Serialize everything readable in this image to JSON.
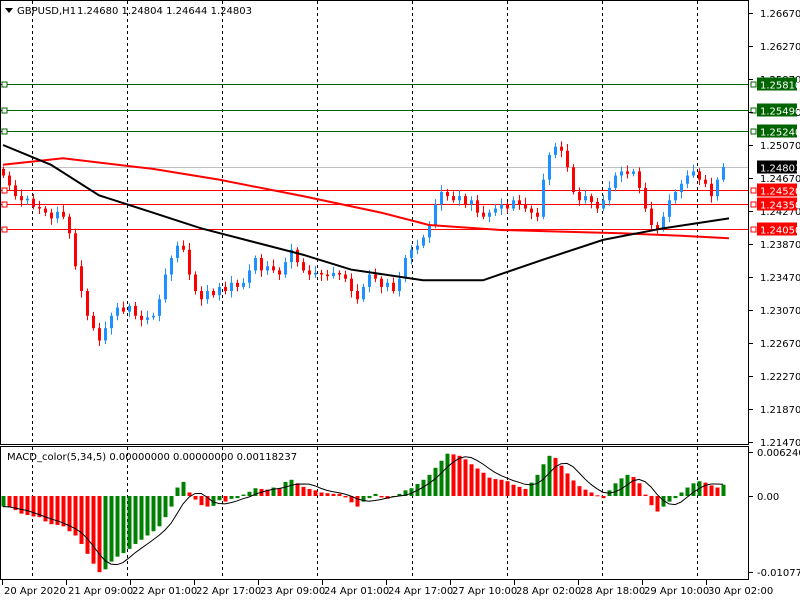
{
  "header": {
    "symbol": "GBPUSD,H1",
    "ohlc": "1.24680 1.24804 1.24644 1.24803",
    "menu_icon": "triangle-down-icon"
  },
  "indicator": {
    "label": "MACD_color(5,34,5) 0.00000000 0.00000000 0.00118237"
  },
  "colors": {
    "bull_candle": "#1E90FF",
    "bear_candle": "#FF0000",
    "ma_fast": "#000000",
    "ma_slow": "#FF0000",
    "level_green": "#006400",
    "level_red": "#FF0000",
    "current_price": "#000000",
    "hist_up": "#008000",
    "hist_down": "#FF0000"
  },
  "chart_data": [
    {
      "type": "candlestick",
      "title": "GBPUSD,H1",
      "x_tick_labels": [
        "20 Apr 2020",
        "21 Apr 09:00",
        "22 Apr 01:00",
        "22 Apr 17:00",
        "23 Apr 09:00",
        "24 Apr 01:00",
        "24 Apr 17:00",
        "27 Apr 10:00",
        "28 Apr 02:00",
        "28 Apr 18:00",
        "29 Apr 10:00",
        "30 Apr 02:00"
      ],
      "y_tick_labels": [
        "1.26670",
        "1.26270",
        "1.25870",
        "1.25470",
        "1.25070",
        "1.24670",
        "1.24270",
        "1.23870",
        "1.23470",
        "1.23070",
        "1.22670",
        "1.22270",
        "1.21870",
        "1.21470"
      ],
      "ylim": [
        1.214,
        1.2683
      ],
      "grid": "vertical dashed",
      "close": [
        1.247,
        1.2458,
        1.2445,
        1.244,
        1.2442,
        1.2432,
        1.243,
        1.2425,
        1.2418,
        1.2426,
        1.242,
        1.24,
        1.236,
        1.233,
        1.23,
        1.2285,
        1.227,
        1.2285,
        1.23,
        1.231,
        1.2305,
        1.2312,
        1.23,
        1.2295,
        1.2298,
        1.23,
        1.232,
        1.235,
        1.237,
        1.2385,
        1.238,
        1.235,
        1.233,
        1.232,
        1.233,
        1.2325,
        1.2335,
        1.233,
        1.234,
        1.2335,
        1.234,
        1.2355,
        1.237,
        1.2355,
        1.236,
        1.2355,
        1.235,
        1.2365,
        1.238,
        1.2365,
        1.2355,
        1.235,
        1.2352,
        1.235,
        1.2348,
        1.2352,
        1.235,
        1.2345,
        1.233,
        1.232,
        1.2335,
        1.235,
        1.2345,
        1.2335,
        1.234,
        1.233,
        1.2345,
        1.237,
        1.238,
        1.2385,
        1.2395,
        1.241,
        1.2435,
        1.245,
        1.2445,
        1.244,
        1.2445,
        1.2435,
        1.244,
        1.2425,
        1.242,
        1.2425,
        1.243,
        1.2435,
        1.243,
        1.244,
        1.2435,
        1.243,
        1.2425,
        1.242,
        1.2465,
        1.2495,
        1.2505,
        1.25,
        1.248,
        1.245,
        1.244,
        1.2445,
        1.2438,
        1.243,
        1.244,
        1.2455,
        1.247,
        1.2475,
        1.2472,
        1.2475,
        1.2455,
        1.243,
        1.241,
        1.2405,
        1.242,
        1.244,
        1.245,
        1.246,
        1.247,
        1.2475,
        1.2465,
        1.246,
        1.2445,
        1.2465,
        1.24803
      ],
      "ma_fast_points": [
        [
          0,
          1.2507
        ],
        [
          8,
          1.2483
        ],
        [
          16,
          1.2446
        ],
        [
          25,
          1.2425
        ],
        [
          33,
          1.2406
        ],
        [
          50,
          1.2374
        ],
        [
          58,
          1.2356
        ],
        [
          70,
          1.2343
        ],
        [
          80,
          1.2343
        ],
        [
          90,
          1.2368
        ],
        [
          100,
          1.2392
        ],
        [
          110,
          1.2406
        ],
        [
          121,
          1.2418
        ]
      ],
      "ma_slow_points": [
        [
          0,
          1.2483
        ],
        [
          10,
          1.2491
        ],
        [
          25,
          1.2478
        ],
        [
          36,
          1.2465
        ],
        [
          50,
          1.2445
        ],
        [
          63,
          1.2425
        ],
        [
          71,
          1.241
        ],
        [
          83,
          1.2404
        ],
        [
          93,
          1.2402
        ],
        [
          103,
          1.24
        ],
        [
          113,
          1.2397
        ],
        [
          121,
          1.2394
        ]
      ],
      "levels": [
        {
          "price": "1.25810",
          "color": "green"
        },
        {
          "price": "1.25490",
          "color": "green"
        },
        {
          "price": "1.25240",
          "color": "green"
        },
        {
          "price": "1.24803",
          "color": "current"
        },
        {
          "price": "1.24520",
          "color": "red"
        },
        {
          "price": "1.24350",
          "color": "red"
        },
        {
          "price": "1.24050",
          "color": "red"
        }
      ]
    },
    {
      "type": "bar",
      "title": "MACD_color(5,34,5)",
      "y_tick_labels": [
        "0.0062401",
        "0.00",
        "-0.010771"
      ],
      "ylim": [
        -0.010771,
        0.0062401
      ],
      "histogram": [
        -0.0015,
        -0.0016,
        -0.002,
        -0.0025,
        -0.0027,
        -0.0029,
        -0.003,
        -0.0036,
        -0.004,
        -0.0041,
        -0.0043,
        -0.005,
        -0.0056,
        -0.0068,
        -0.0082,
        -0.0096,
        -0.0108,
        -0.0104,
        -0.0093,
        -0.0086,
        -0.0081,
        -0.0075,
        -0.0068,
        -0.0062,
        -0.0056,
        -0.005,
        -0.0043,
        -0.003,
        -0.0015,
        0.0012,
        0.002,
        0.0005,
        -0.0005,
        -0.0013,
        -0.0015,
        -0.0014,
        -0.0006,
        -0.0008,
        -0.0004,
        -0.0003,
        0.0002,
        0.0006,
        0.0011,
        0.001,
        0.0009,
        0.0012,
        0.0011,
        0.002,
        0.0023,
        0.0018,
        0.0013,
        0.001,
        0.0008,
        0.0005,
        0.0004,
        0.0003,
        0.0003,
        -0.0002,
        -0.0009,
        -0.0015,
        -0.0008,
        -0.0003,
        0.0003,
        -0.0002,
        -0.0004,
        0.0,
        0.0003,
        0.0008,
        0.0011,
        0.0017,
        0.0023,
        0.003,
        0.004,
        0.005,
        0.006,
        0.0059,
        0.0057,
        0.0052,
        0.0045,
        0.0039,
        0.0033,
        0.0026,
        0.0024,
        0.0023,
        0.0021,
        0.0016,
        0.0013,
        0.001,
        0.0019,
        0.003,
        0.0045,
        0.0057,
        0.0054,
        0.0043,
        0.0032,
        0.0022,
        0.0014,
        0.0009,
        0.0005,
        0.0001,
        -0.0003,
        0.0008,
        0.0018,
        0.0025,
        0.003,
        0.0027,
        0.0018,
        0.0002,
        -0.0013,
        -0.0022,
        -0.0015,
        -0.0008,
        -0.0003,
        0.0005,
        0.0012,
        0.0018,
        0.0021,
        0.0019,
        0.0015,
        0.0012,
        0.0016
      ]
    }
  ]
}
